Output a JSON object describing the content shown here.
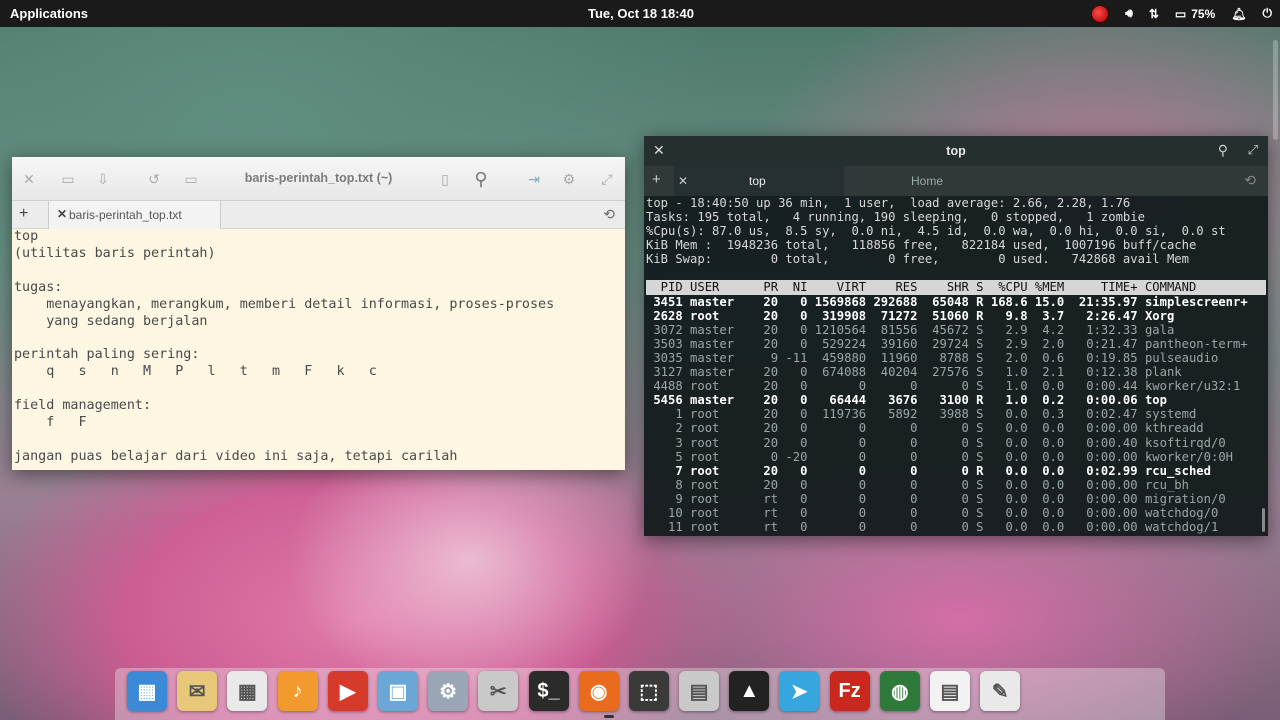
{
  "panel": {
    "applications": "Applications",
    "clock": "Tue, Oct 18   18:40",
    "battery": "75%"
  },
  "editor": {
    "title": "baris-perintah_top.txt (~)",
    "tab_label": "baris-perintah_top.txt",
    "lines": [
      "top",
      "(utilitas baris perintah)",
      "",
      "tugas:",
      "    menayangkan, merangkum, memberi detail informasi, proses-proses",
      "    yang sedang berjalan",
      "",
      "perintah paling sering:",
      "    q   s   n   M   P   l   t   m   F   k   c",
      "",
      "field management:",
      "    f   F",
      "",
      "jangan puas belajar dari video ini saja, tetapi carilah"
    ]
  },
  "terminal": {
    "title": "top",
    "tabs": [
      "top",
      "Home"
    ],
    "summary": [
      "top - 18:40:50 up 36 min,  1 user,  load average: 2.66, 2.28, 1.76",
      "Tasks: 195 total,   4 running, 190 sleeping,   0 stopped,   1 zombie",
      "%Cpu(s): 87.0 us,  8.5 sy,  0.0 ni,  4.5 id,  0.0 wa,  0.0 hi,  0.0 si,  0.0 st",
      "KiB Mem :  1948236 total,   118856 free,   822184 used,  1007196 buff/cache",
      "KiB Swap:        0 total,        0 free,        0 used.   742868 avail Mem"
    ],
    "header": "  PID USER      PR  NI    VIRT    RES    SHR S  %CPU %MEM     TIME+ COMMAND        ",
    "processes": [
      {
        "text": " 3451 master    20   0 1569868 292688  65048 R 168.6 15.0  21:35.97 simplescreenr+",
        "running": true
      },
      {
        "text": " 2628 root      20   0  319908  71272  51060 R   9.8  3.7   2:26.47 Xorg",
        "running": true
      },
      {
        "text": " 3072 master    20   0 1210564  81556  45672 S   2.9  4.2   1:32.33 gala",
        "running": false
      },
      {
        "text": " 3503 master    20   0  529224  39160  29724 S   2.9  2.0   0:21.47 pantheon-term+",
        "running": false
      },
      {
        "text": " 3035 master     9 -11  459880  11960   8788 S   2.0  0.6   0:19.85 pulseaudio",
        "running": false
      },
      {
        "text": " 3127 master    20   0  674088  40204  27576 S   1.0  2.1   0:12.38 plank",
        "running": false
      },
      {
        "text": " 4488 root      20   0       0      0      0 S   1.0  0.0   0:00.44 kworker/u32:1",
        "running": false
      },
      {
        "text": " 5456 master    20   0   66444   3676   3100 R   1.0  0.2   0:00.06 top",
        "running": true
      },
      {
        "text": "    1 root      20   0  119736   5892   3988 S   0.0  0.3   0:02.47 systemd",
        "running": false
      },
      {
        "text": "    2 root      20   0       0      0      0 S   0.0  0.0   0:00.00 kthreadd",
        "running": false
      },
      {
        "text": "    3 root      20   0       0      0      0 S   0.0  0.0   0:00.40 ksoftirqd/0",
        "running": false
      },
      {
        "text": "    5 root       0 -20       0      0      0 S   0.0  0.0   0:00.00 kworker/0:0H",
        "running": false
      },
      {
        "text": "    7 root      20   0       0      0      0 R   0.0  0.0   0:02.99 rcu_sched",
        "running": true
      },
      {
        "text": "    8 root      20   0       0      0      0 S   0.0  0.0   0:00.00 rcu_bh",
        "running": false
      },
      {
        "text": "    9 root      rt   0       0      0      0 S   0.0  0.0   0:00.00 migration/0",
        "running": false
      },
      {
        "text": "   10 root      rt   0       0      0      0 S   0.0  0.0   0:00.00 watchdog/0",
        "running": false
      },
      {
        "text": "   11 root      rt   0       0      0      0 S   0.0  0.0   0:00.00 watchdog/1",
        "running": false
      }
    ]
  },
  "dock": [
    {
      "name": "multitasking-view-icon",
      "color": "#3a8ad8",
      "glyph": "▦"
    },
    {
      "name": "mail-icon",
      "color": "#e8c77a",
      "glyph": "✉"
    },
    {
      "name": "calendar-icon",
      "color": "#e9e9e9",
      "glyph": "▦"
    },
    {
      "name": "music-icon",
      "color": "#f29a2e",
      "glyph": "♪"
    },
    {
      "name": "videos-icon",
      "color": "#d63a2a",
      "glyph": "▶"
    },
    {
      "name": "photos-icon",
      "color": "#6aa6d6",
      "glyph": "▣"
    },
    {
      "name": "settings-icon",
      "color": "#9aa6b5",
      "glyph": "⚙"
    },
    {
      "name": "screenshot-scissors-icon",
      "color": "#c9c9c9",
      "glyph": "✂"
    },
    {
      "name": "terminal-icon",
      "color": "#2b2b2b",
      "glyph": "$_"
    },
    {
      "name": "firefox-icon",
      "color": "#e96b1e",
      "glyph": "◉"
    },
    {
      "name": "screen-capture-icon",
      "color": "#3a3a3a",
      "glyph": "⬚"
    },
    {
      "name": "files-icon",
      "color": "#c9c9c9",
      "glyph": "▤"
    },
    {
      "name": "inkscape-icon",
      "color": "#222222",
      "glyph": "▲"
    },
    {
      "name": "telegram-icon",
      "color": "#35a6de",
      "glyph": "➤"
    },
    {
      "name": "filezilla-icon",
      "color": "#c9281f",
      "glyph": "Fz"
    },
    {
      "name": "globe-icon",
      "color": "#2f7a3a",
      "glyph": "◍"
    },
    {
      "name": "document-viewer-icon",
      "color": "#f2f2f2",
      "glyph": "▤"
    },
    {
      "name": "text-editor-icon",
      "color": "#e9e9e9",
      "glyph": "✎"
    }
  ]
}
